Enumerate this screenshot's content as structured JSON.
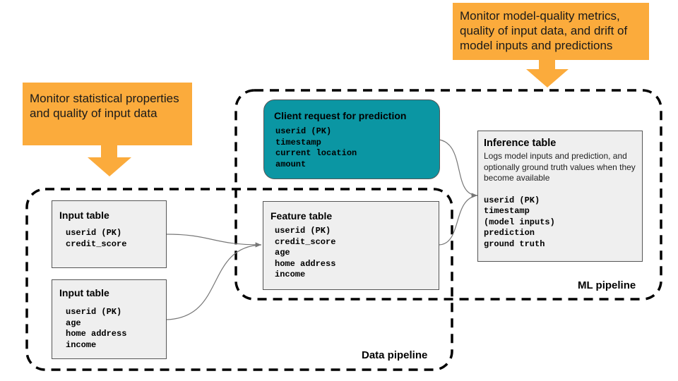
{
  "callouts": {
    "ml_monitor": "Monitor model-quality metrics, quality of input data, and drift of model inputs and predictions",
    "data_monitor": "Monitor statistical properties and quality of input data"
  },
  "colors": {
    "callout": "#fbab3c",
    "client_box": "#0b96a3",
    "table_box": "#efefef",
    "connector": "#777777"
  },
  "pipelines": {
    "ml": "ML pipeline",
    "data": "Data pipeline"
  },
  "tables": {
    "client_request": {
      "title": "Client request for prediction",
      "fields": "userid (PK)\ntimestamp\ncurrent location\namount"
    },
    "inference": {
      "title": "Inference table",
      "description": "Logs model inputs and prediction, and optionally ground truth values when they become available",
      "fields": "userid (PK)\ntimestamp\n(model inputs)\nprediction\nground truth"
    },
    "input_1": {
      "title": "Input table",
      "fields": "userid (PK)\ncredit_score"
    },
    "input_2": {
      "title": "Input table",
      "fields": "userid (PK)\nage\nhome address\nincome"
    },
    "feature": {
      "title": "Feature table",
      "fields": "userid (PK)\ncredit_score\nage\nhome address\nincome"
    }
  },
  "connections": [
    {
      "from": "input_1",
      "to": "feature"
    },
    {
      "from": "input_2",
      "to": "feature"
    },
    {
      "from": "client_request",
      "to": "inference"
    },
    {
      "from": "feature",
      "to": "inference"
    }
  ]
}
